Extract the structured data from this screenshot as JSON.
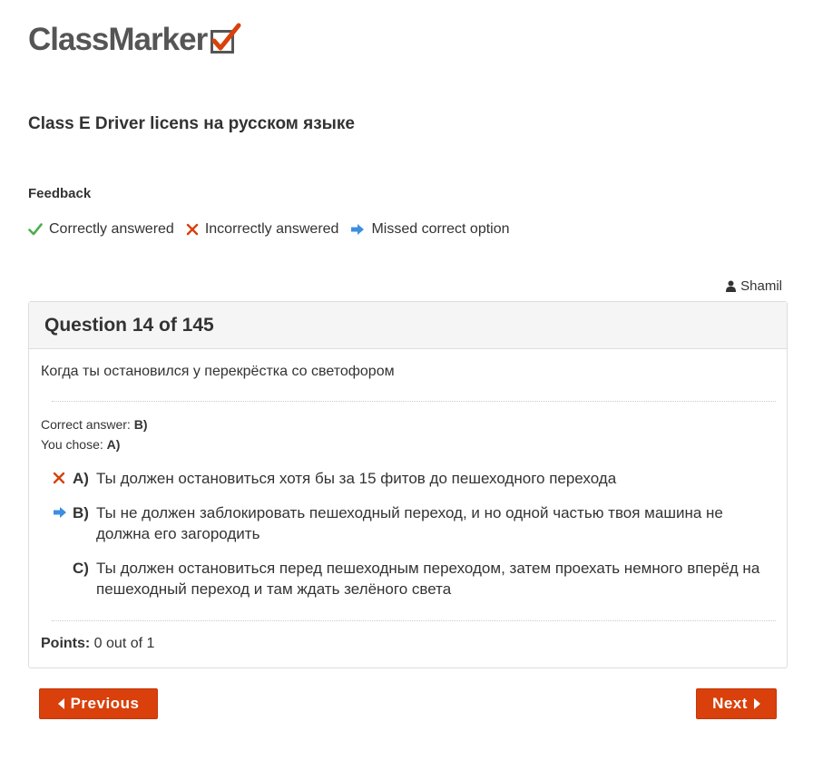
{
  "brand": {
    "logo_text": "ClassMarker",
    "accent_color": "#d9400b"
  },
  "test": {
    "title": "Class E Driver licens на русском языке"
  },
  "feedback": {
    "title": "Feedback",
    "legend": [
      {
        "icon": "check-icon",
        "label": "Correctly answered",
        "color": "#4caf50"
      },
      {
        "icon": "cross-icon",
        "label": "Incorrectly answered",
        "color": "#d9400b"
      },
      {
        "icon": "arrow-right-icon",
        "label": "Missed correct option",
        "color": "#3b8fe0"
      }
    ]
  },
  "user": {
    "icon": "user-icon",
    "name": "Shamil"
  },
  "question": {
    "heading": "Question 14 of 145",
    "text": "Когда ты остановился у перекрёстка со светофором",
    "correct_answer_label": "Correct answer:",
    "correct_answer_value": "B)",
    "you_chose_label": "You chose:",
    "you_chose_value": "A)",
    "options": [
      {
        "letter": "A)",
        "text": "Ты должен остановиться хотя бы за 15 фитов до пешеходного перехода",
        "mark": "cross-icon"
      },
      {
        "letter": "B)",
        "text": "Ты не должен заблокировать пешеходный переход, и но одной частью твоя машина не должна его загородить",
        "mark": "arrow-right-icon"
      },
      {
        "letter": "C)",
        "text": "Ты должен остановиться перед пешеходным переходом, затем проехать немного вперёд на пешеходный переход и там ждать зелёного света",
        "mark": ""
      }
    ],
    "points_label": "Points:",
    "points_value": "0 out of 1"
  },
  "nav": {
    "previous_label": "Previous",
    "next_label": "Next"
  }
}
